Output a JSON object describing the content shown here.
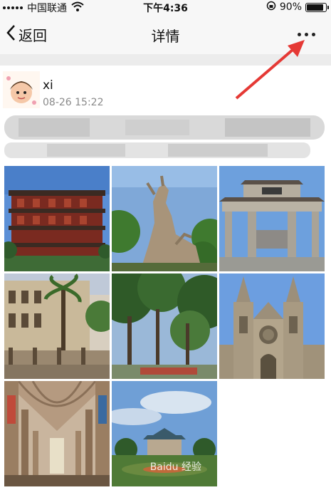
{
  "status_bar": {
    "carrier": "中国联通",
    "time": "下午4:36",
    "battery": "90%",
    "battery_level": 0.9
  },
  "nav": {
    "back_label": "返回",
    "title": "详情"
  },
  "post": {
    "username": "xi",
    "timestamp": "08-26 15:22"
  },
  "colors": {
    "annotation_arrow": "#e53935",
    "nav_background": "#f7f7f7"
  },
  "photos": [
    "tower",
    "goat-statue",
    "archway",
    "colonial-building",
    "park-trees",
    "cathedral",
    "church-interior",
    "memorial-hall"
  ],
  "watermark": "Baidu 经验"
}
